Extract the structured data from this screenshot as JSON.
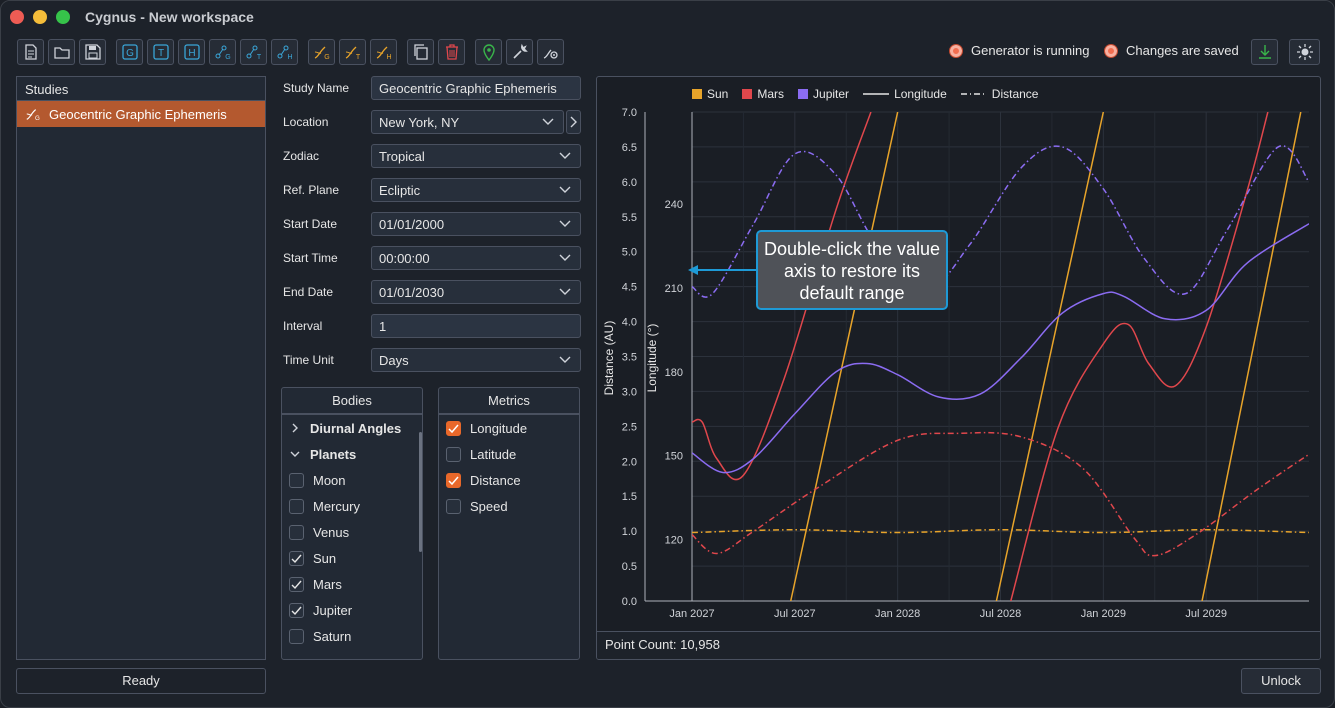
{
  "window": {
    "title": "Cygnus - New workspace"
  },
  "toolbar": {
    "icons": [
      "new-file-icon",
      "open-folder-icon",
      "save-icon",
      "g-icon",
      "t-icon",
      "h-icon",
      "chart-g-icon",
      "chart-t-icon",
      "chart-h-icon",
      "graph-g-icon",
      "graph-t-icon",
      "graph-h-icon",
      "copy-icon",
      "trash-icon",
      "location-pin-icon",
      "wrench-icon",
      "settings-chart-icon"
    ],
    "generator_status": "Generator is running",
    "save_status": "Changes are saved"
  },
  "studies": {
    "header": "Studies",
    "items": [
      {
        "label": "Geocentric Graphic Ephemeris"
      }
    ]
  },
  "status_bar": {
    "text": "Ready"
  },
  "form": {
    "study_name": {
      "label": "Study Name",
      "value": "Geocentric Graphic Ephemeris"
    },
    "location": {
      "label": "Location",
      "value": "New York, NY"
    },
    "zodiac": {
      "label": "Zodiac",
      "value": "Tropical"
    },
    "ref_plane": {
      "label": "Ref. Plane",
      "value": "Ecliptic"
    },
    "start_date": {
      "label": "Start Date",
      "value": "01/01/2000"
    },
    "start_time": {
      "label": "Start Time",
      "value": "00:00:00"
    },
    "end_date": {
      "label": "End Date",
      "value": "01/01/2030"
    },
    "interval": {
      "label": "Interval",
      "value": "1"
    },
    "time_unit": {
      "label": "Time Unit",
      "value": "Days"
    }
  },
  "bodies": {
    "header": "Bodies",
    "groups": [
      {
        "label": "Diurnal Angles",
        "expanded": false
      },
      {
        "label": "Planets",
        "expanded": true
      }
    ],
    "items": [
      {
        "label": "Moon",
        "checked": false
      },
      {
        "label": "Mercury",
        "checked": false
      },
      {
        "label": "Venus",
        "checked": false
      },
      {
        "label": "Sun",
        "checked": true
      },
      {
        "label": "Mars",
        "checked": true
      },
      {
        "label": "Jupiter",
        "checked": true
      },
      {
        "label": "Saturn",
        "checked": false
      }
    ]
  },
  "metrics": {
    "header": "Metrics",
    "items": [
      {
        "label": "Longitude",
        "checked": true
      },
      {
        "label": "Latitude",
        "checked": false
      },
      {
        "label": "Distance",
        "checked": true
      },
      {
        "label": "Speed",
        "checked": false
      }
    ]
  },
  "chart": {
    "legend": [
      {
        "label": "Sun",
        "color": "#e8a42a"
      },
      {
        "label": "Mars",
        "color": "#e0474c"
      },
      {
        "label": "Jupiter",
        "color": "#8b6cf2"
      },
      {
        "label": "Longitude",
        "style": "solid"
      },
      {
        "label": "Distance",
        "style": "dash-dot"
      }
    ],
    "callout": "Double-click the value axis to restore its default range",
    "point_count_label": "Point Count:",
    "point_count": "10,958"
  },
  "chart_data": {
    "type": "line",
    "xlabel": "",
    "ylabel_left": "Distance (AU)",
    "ylabel_right": "Longitude (°)",
    "x_ticks": [
      "Jan 2027",
      "Jul 2027",
      "Jan 2028",
      "Jul 2028",
      "Jan 2029",
      "Jul 2029"
    ],
    "xlim": [
      2027.0,
      2030.0
    ],
    "distance_ticks": [
      0.0,
      0.5,
      1.0,
      1.5,
      2.0,
      2.5,
      3.0,
      3.5,
      4.0,
      4.5,
      5.0,
      5.5,
      6.0,
      6.5,
      7.0
    ],
    "distance_ylim": [
      0.0,
      7.0
    ],
    "longitude_ticks": [
      120,
      150,
      180,
      210,
      240
    ],
    "longitude_ylim": [
      98,
      273
    ],
    "grid": true,
    "legend_position": "top",
    "series": [
      {
        "name": "Sun",
        "metric": "Longitude",
        "color": "#e8a42a",
        "style": "solid",
        "segments": [
          [
            [
              2027.48,
              98
            ],
            [
              2028.0,
              273
            ]
          ],
          [
            [
              2028.48,
              98
            ],
            [
              2029.0,
              273
            ]
          ],
          [
            [
              2029.48,
              98
            ],
            [
              2029.96,
              273
            ]
          ]
        ]
      },
      {
        "name": "Mars",
        "metric": "Longitude",
        "color": "#e0474c",
        "style": "solid",
        "points": [
          [
            2027.0,
            162
          ],
          [
            2027.05,
            162
          ],
          [
            2027.12,
            149
          ],
          [
            2027.25,
            143
          ],
          [
            2027.45,
            178
          ],
          [
            2027.7,
            238
          ],
          [
            2027.87,
            273
          ]
        ],
        "segments2": [
          [
            2028.55,
            98
          ],
          [
            2028.78,
            160
          ],
          [
            2029.0,
            190
          ],
          [
            2029.12,
            197
          ],
          [
            2029.22,
            183
          ],
          [
            2029.35,
            175
          ],
          [
            2029.5,
            196
          ],
          [
            2029.7,
            245
          ],
          [
            2029.8,
            273
          ]
        ]
      },
      {
        "name": "Jupiter",
        "metric": "Longitude",
        "color": "#8b6cf2",
        "style": "solid",
        "points": [
          [
            2027.0,
            151
          ],
          [
            2027.15,
            144
          ],
          [
            2027.3,
            149
          ],
          [
            2027.5,
            165
          ],
          [
            2027.7,
            180
          ],
          [
            2027.85,
            183
          ],
          [
            2028.0,
            179
          ],
          [
            2028.2,
            171
          ],
          [
            2028.4,
            172
          ],
          [
            2028.6,
            185
          ],
          [
            2028.8,
            201
          ],
          [
            2029.0,
            208
          ],
          [
            2029.1,
            207
          ],
          [
            2029.3,
            199
          ],
          [
            2029.5,
            202
          ],
          [
            2029.7,
            219
          ],
          [
            2030.0,
            233
          ]
        ]
      },
      {
        "name": "Sun",
        "metric": "Distance",
        "color": "#e8a42a",
        "style": "dash-dot",
        "points": [
          [
            2027.0,
            0.98
          ],
          [
            2027.5,
            1.02
          ],
          [
            2028.0,
            0.98
          ],
          [
            2028.5,
            1.02
          ],
          [
            2029.0,
            0.98
          ],
          [
            2029.5,
            1.02
          ],
          [
            2030.0,
            0.98
          ]
        ]
      },
      {
        "name": "Mars",
        "metric": "Distance",
        "color": "#e0474c",
        "style": "dash-dot",
        "points": [
          [
            2027.0,
            0.95
          ],
          [
            2027.12,
            0.68
          ],
          [
            2027.3,
            1.0
          ],
          [
            2027.6,
            1.6
          ],
          [
            2028.0,
            2.3
          ],
          [
            2028.3,
            2.4
          ],
          [
            2028.6,
            2.35
          ],
          [
            2028.9,
            1.9
          ],
          [
            2029.15,
            0.9
          ],
          [
            2029.25,
            0.65
          ],
          [
            2029.45,
            0.95
          ],
          [
            2029.75,
            1.6
          ],
          [
            2030.0,
            2.1
          ]
        ]
      },
      {
        "name": "Jupiter",
        "metric": "Distance",
        "color": "#8b6cf2",
        "style": "dash-dot",
        "points": [
          [
            2027.0,
            4.5
          ],
          [
            2027.1,
            4.4
          ],
          [
            2027.3,
            5.4
          ],
          [
            2027.5,
            6.4
          ],
          [
            2027.7,
            6.1
          ],
          [
            2027.9,
            5.1
          ],
          [
            2028.15,
            4.5
          ],
          [
            2028.35,
            5.1
          ],
          [
            2028.6,
            6.2
          ],
          [
            2028.8,
            6.5
          ],
          [
            2029.0,
            5.9
          ],
          [
            2029.2,
            4.9
          ],
          [
            2029.4,
            4.4
          ],
          [
            2029.6,
            5.3
          ],
          [
            2029.85,
            6.5
          ],
          [
            2030.0,
            6.0
          ]
        ]
      }
    ]
  }
}
